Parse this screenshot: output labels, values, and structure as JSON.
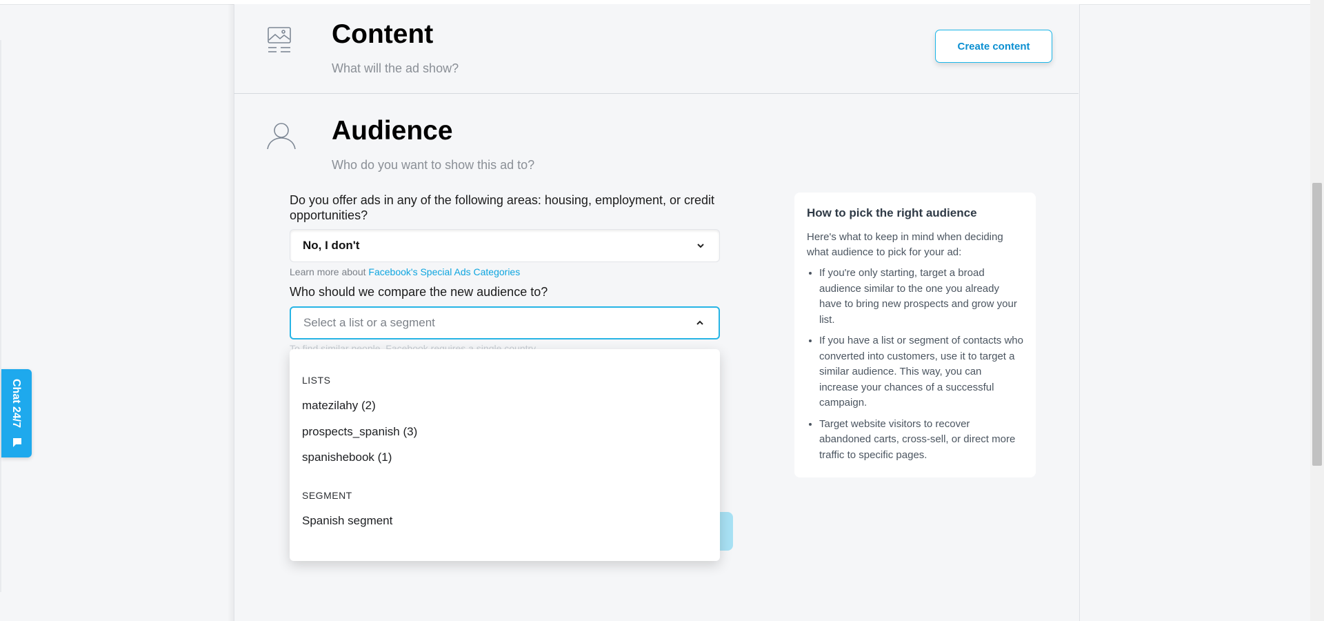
{
  "content_section": {
    "title": "Content",
    "subtitle": "What will the ad show?",
    "button_label": "Create content",
    "icon": "image-icon"
  },
  "audience_section": {
    "title": "Audience",
    "subtitle": "Who do you want to show this ad to?",
    "icon": "user-icon",
    "question1": "Do you offer ads in any of the following areas: housing, employment, or credit opportunities?",
    "select1_value": "No, I don't",
    "help_prefix": "Learn more about",
    "help_link": "Facebook's Special Ads Categories",
    "question2": "Who should we compare the new audience to?",
    "select2_placeholder": "Select a list or a segment",
    "hidden_hint": "To find similar people, Facebook requires a single country"
  },
  "dropdown": {
    "lists_header": "LISTS",
    "lists": [
      "matezilahy (2)",
      "prospects_spanish (3)",
      "spanishebook (1)"
    ],
    "segment_header": "SEGMENT",
    "segments": [
      "Spanish segment"
    ]
  },
  "info_card": {
    "title": "How to pick the right audience",
    "intro": "Here's what to keep in mind when deciding what audience to pick for your ad:",
    "bullets": [
      "If you're only starting, target a broad audience similar to the one you already have to bring new prospects and grow your list.",
      "If you have a list or segment of contacts who converted into customers, use it to target a similar audience. This way, you can increase your chances of a successful campaign.",
      "Target website visitors to recover abandoned carts, cross-sell, or direct more traffic to specific pages."
    ]
  },
  "chat": {
    "label": "Chat 24/7",
    "icon": "chat-bubble-icon"
  },
  "colors": {
    "accent": "#1ab5e8",
    "link": "#0ea5df",
    "chat": "#1ea9ed"
  }
}
